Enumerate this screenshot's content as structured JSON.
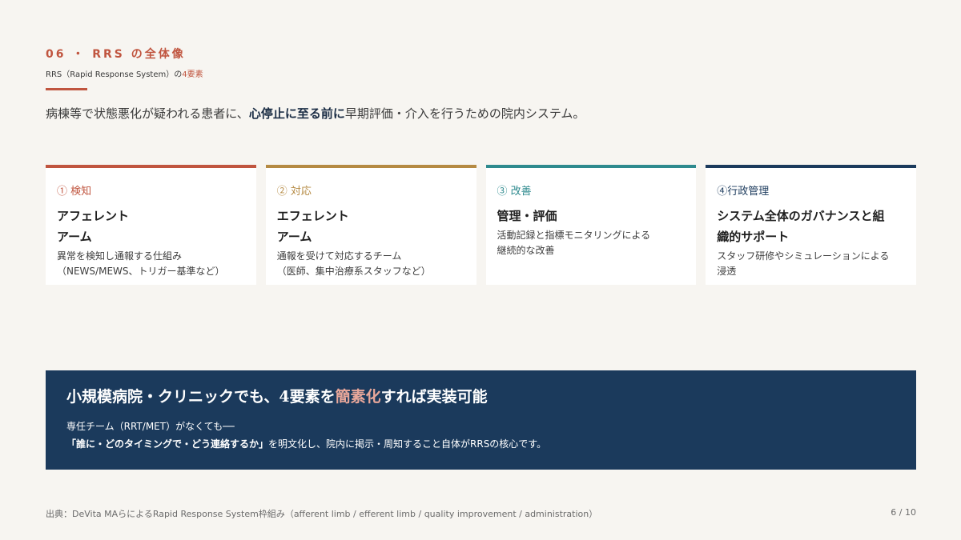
{
  "header": {
    "section_label": "06 ・ RRS の全体像",
    "subtitle_prefix": "RRS（Rapid Response System）の",
    "subtitle_accent": "4要素",
    "lead_before": "病棟等で状態悪化が疑われる患者に、",
    "lead_strong": "心停止に至る前に",
    "lead_after": "早期評価・介入を行うための院内システム。"
  },
  "cards": [
    {
      "num": "① 検知",
      "title_lines": [
        "アフェレント",
        "アーム"
      ],
      "desc_lines": [
        "異常を検知し通報する仕組み",
        "（NEWS/MEWS、トリガー基準など）"
      ],
      "color": "#c0553f"
    },
    {
      "num": "② 対応",
      "title_lines": [
        "エフェレント",
        "アーム"
      ],
      "desc_lines": [
        "通報を受けて対応するチーム",
        "（医師、集中治療系スタッフなど）"
      ],
      "color": "#b58a43"
    },
    {
      "num": "③ 改善",
      "title_lines": [
        "管理・評価"
      ],
      "desc_lines": [
        "活動記録と指標モニタリングによる",
        "継続的な改善"
      ],
      "color": "#2e8a8e"
    },
    {
      "num": "④行政管理",
      "title_lines": [
        "システム全体のガバナンスと組",
        "織的サポート"
      ],
      "desc_lines": [
        "スタッフ研修やシミュレーションによる",
        "浸透"
      ],
      "color": "#1b3a5c"
    }
  ],
  "banner": {
    "head_before": "小規模病院・クリニックでも、4要素を",
    "head_highlight": "簡素化",
    "head_after": "すれば実装可能",
    "line1": "専任チーム（RRT/MET）がなくても──",
    "line2_strong": "「誰に・どのタイミングで・どう連絡するか」",
    "line2_after": "を明文化し、院内に掲示・周知すること自体がRRSの核心です。"
  },
  "footer": {
    "source": "出典：DeVita MAらによるRapid Response System枠組み（afferent limb / efferent limb / quality improvement / administration）",
    "page": "6 / 10"
  }
}
